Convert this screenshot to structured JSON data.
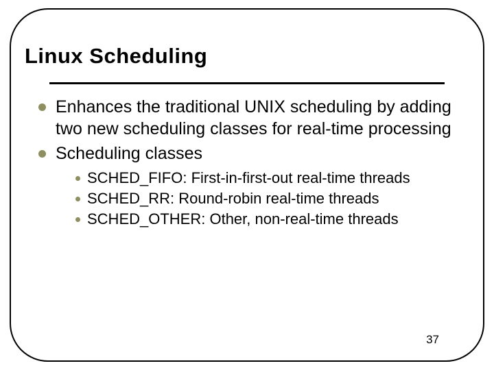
{
  "slide": {
    "title": "Linux Scheduling",
    "bullets": [
      {
        "text": "Enhances the traditional UNIX scheduling by adding two new scheduling classes for real-time processing"
      },
      {
        "text": "Scheduling classes"
      }
    ],
    "subbullets": [
      {
        "text": "SCHED_FIFO: First-in-first-out real-time threads"
      },
      {
        "text": "SCHED_RR: Round-robin real-time threads"
      },
      {
        "text": "SCHED_OTHER: Other, non-real-time threads"
      }
    ],
    "page_number": "37"
  }
}
